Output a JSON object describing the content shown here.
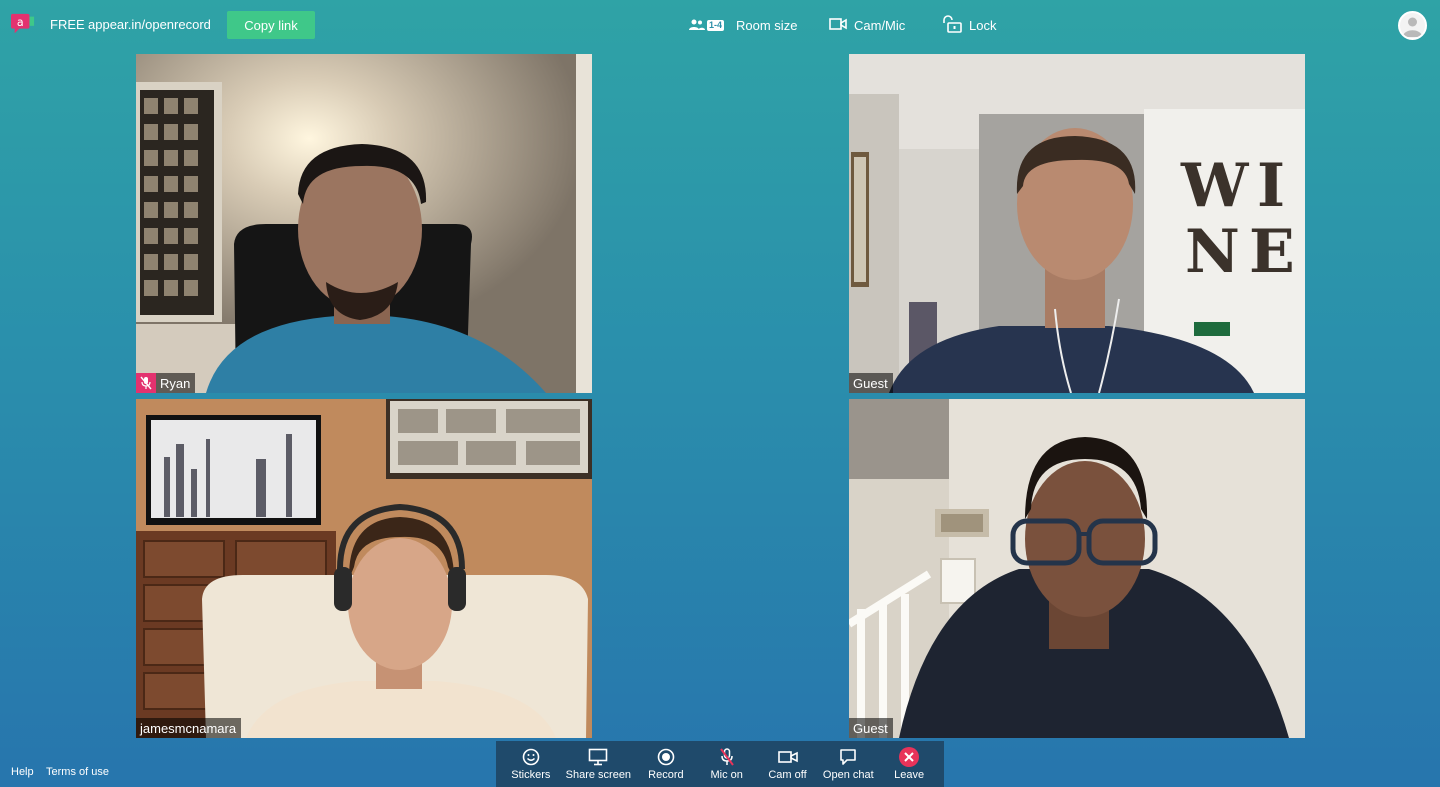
{
  "header": {
    "plan": "FREE",
    "room_url": "appear.in/openrecord",
    "copy_label": "Copy link",
    "room_size_badge": "1-4",
    "room_size_label": "Room size",
    "cam_mic_label": "Cam/Mic",
    "lock_label": "Lock"
  },
  "participants": [
    {
      "name": "Ryan",
      "muted": true
    },
    {
      "name": "Guest",
      "muted": false
    },
    {
      "name": "jamesmcnamara",
      "muted": false
    },
    {
      "name": "Guest",
      "muted": false
    }
  ],
  "toolbar": {
    "stickers": "Stickers",
    "share_screen": "Share screen",
    "record": "Record",
    "mic": "Mic on",
    "cam": "Cam off",
    "chat": "Open chat",
    "leave": "Leave"
  },
  "footer": {
    "help": "Help",
    "terms": "Terms of use"
  },
  "colors": {
    "accent_green": "#3fc889",
    "logo_pink": "#e3326f",
    "leave_red": "#e8335a",
    "toolbar_bg": "#1f4a6b"
  }
}
